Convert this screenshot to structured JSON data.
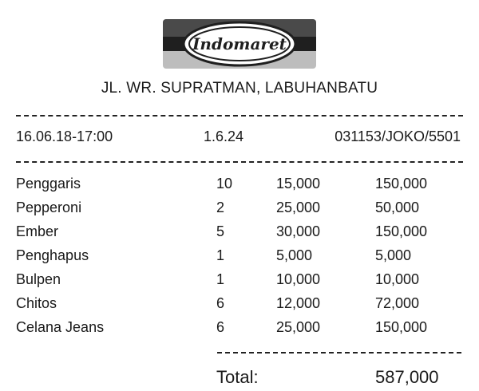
{
  "store": {
    "logo_text": "Indomaret",
    "address": "JL. WR. SUPRATMAN, LABUHANBATU"
  },
  "meta": {
    "datetime": "16.06.18-17:00",
    "version": "1.6.24",
    "code": "031153/JOKO/5501"
  },
  "items": [
    {
      "name": "Penggaris",
      "qty": "10",
      "price": "15,000",
      "total": "150,000"
    },
    {
      "name": "Pepperoni",
      "qty": "2",
      "price": "25,000",
      "total": "50,000"
    },
    {
      "name": "Ember",
      "qty": "5",
      "price": "30,000",
      "total": "150,000"
    },
    {
      "name": "Penghapus",
      "qty": "1",
      "price": "5,000",
      "total": "5,000"
    },
    {
      "name": "Bulpen",
      "qty": "1",
      "price": "10,000",
      "total": "10,000"
    },
    {
      "name": "Chitos",
      "qty": "6",
      "price": "12,000",
      "total": "72,000"
    },
    {
      "name": "Celana Jeans",
      "qty": "6",
      "price": "25,000",
      "total": "150,000"
    }
  ],
  "summary": {
    "total_label": "Total:",
    "total_value": "587,000"
  }
}
